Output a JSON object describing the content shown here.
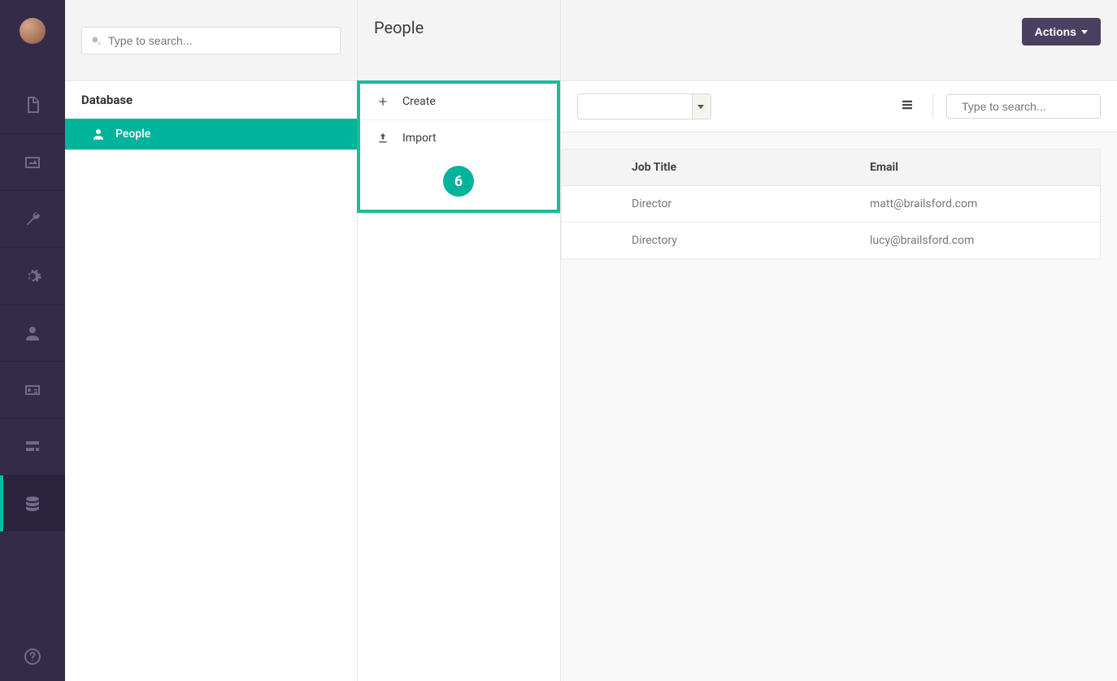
{
  "search": {
    "placeholder_left": "Type to search...",
    "placeholder_right": "Type to search..."
  },
  "tree": {
    "section_title": "Database",
    "items": [
      {
        "label": "People"
      }
    ]
  },
  "panel": {
    "title": "People",
    "actions": [
      {
        "label": "Create"
      },
      {
        "label": "Import"
      }
    ],
    "step_badge": "6"
  },
  "main": {
    "actions_button": "Actions",
    "columns": {
      "job_title": "Job Title",
      "email": "Email"
    },
    "rows": [
      {
        "job_title": "Director",
        "email": "matt@brailsford.com"
      },
      {
        "job_title": "Directory",
        "email": "lucy@brailsford.com"
      }
    ]
  }
}
